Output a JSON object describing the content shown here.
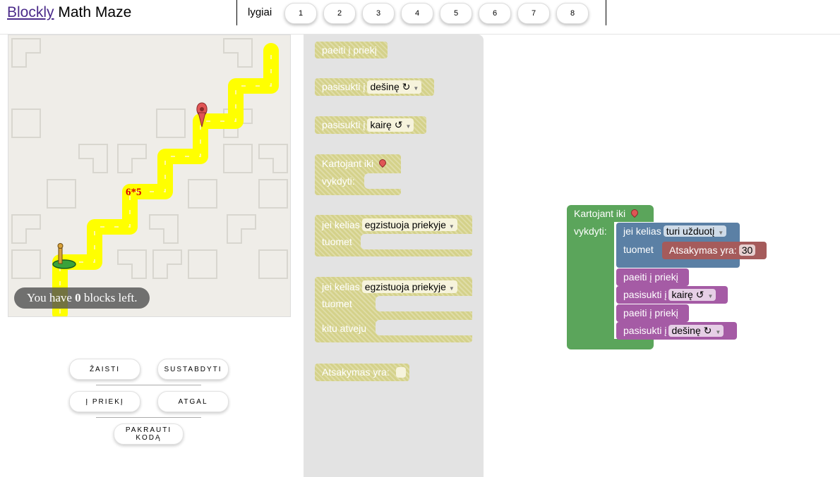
{
  "header": {
    "title_link": "Blockly",
    "title_rest": "Math Maze",
    "levels_label": "lygiai",
    "levels": [
      "1",
      "2",
      "3",
      "4",
      "5",
      "6",
      "7",
      "8"
    ]
  },
  "maze": {
    "path_label": "6*5",
    "blocks_left_prefix": "You have ",
    "blocks_left_count": "0",
    "blocks_left_suffix": " blocks left.",
    "path_color": "#ffff00",
    "background_color": "#efede8"
  },
  "controls": {
    "play": "ŽAISTI",
    "stop": "SUSTABDYTI",
    "forward": "Į PRIEKĮ",
    "back": "ATGAL",
    "load_code": "PAKRAUTI KODĄ"
  },
  "toolbox": {
    "move_forward": "paeiti į priekį",
    "turn_label": "pasisukti į",
    "turn_right": "dešinę ↻",
    "turn_left": "kairę ↺",
    "repeat_until": "Kartojant iki",
    "do": "vykdyti:",
    "if_path": "jei kelias",
    "path_ahead": "egzistuoja priekyje",
    "then": "tuomet",
    "else": "kitu atveju",
    "answer": "Atsakymas yra:",
    "block_color": "#d4d18a"
  },
  "workspace": {
    "repeat_until": "Kartojant iki",
    "do": "vykdyti:",
    "if_path": "jei kelias",
    "condition": "turi užduotį",
    "then": "tuomet",
    "answer_label": "Atsakymas yra:",
    "answer_value": "30",
    "step1": "paeiti į priekį",
    "step2_label": "pasisukti į",
    "step2_dir": "kairę ↺",
    "step3": "paeiti į priekį",
    "step4_label": "pasisukti į",
    "step4_dir": "dešinę ↻",
    "colors": {
      "loop": "#5ba55b",
      "if": "#5b80a5",
      "answer": "#a55b5b",
      "move": "#a55ba5"
    }
  }
}
